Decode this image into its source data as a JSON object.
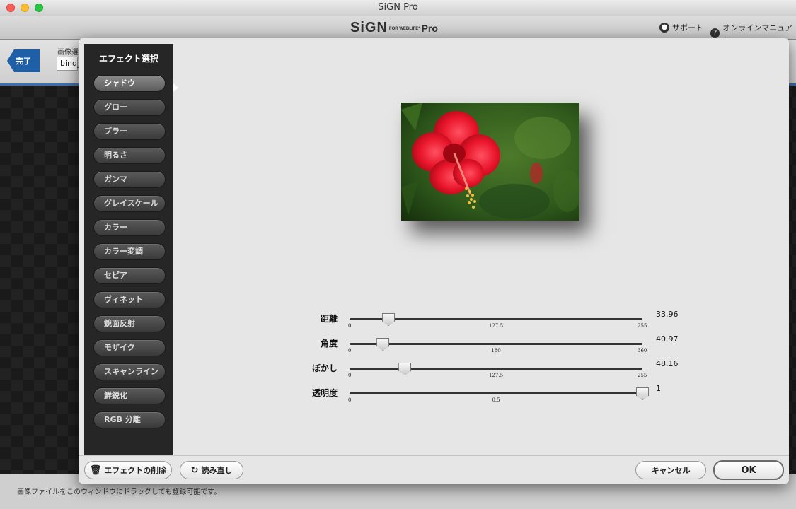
{
  "window": {
    "title": "SiGN Pro"
  },
  "app": {
    "logo_main": "SiGN",
    "logo_sub": "FOR WEBLIFE*",
    "logo_pro": "Pro",
    "support_label": "サポート",
    "manual_label": "オンラインマニュアル"
  },
  "background": {
    "done_label": "完了",
    "field_label": "画像選",
    "field_value": "bind_",
    "status_text": "画像ファイルをこのウィンドウにドラッグしても登録可能です。"
  },
  "dialog": {
    "sidebar_title": "エフェクト選択",
    "effects": [
      "シャドウ",
      "グロー",
      "ブラー",
      "明るさ",
      "ガンマ",
      "グレイスケール",
      "カラー",
      "カラー変調",
      "セピア",
      "ヴィネット",
      "鏡面反射",
      "モザイク",
      "スキャンライン",
      "鮮鋭化",
      "RGB 分離"
    ],
    "active_effect_index": 0,
    "sliders": [
      {
        "label": "距離",
        "min": "0",
        "mid": "127.5",
        "max": "255",
        "value": "33.96",
        "fraction": 0.133
      },
      {
        "label": "角度",
        "min": "0",
        "mid": "180",
        "max": "360",
        "value": "40.97",
        "fraction": 0.114
      },
      {
        "label": "ぼかし",
        "min": "0",
        "mid": "127.5",
        "max": "255",
        "value": "48.16",
        "fraction": 0.189
      },
      {
        "label": "透明度",
        "min": "0",
        "mid": "0.5",
        "max": "",
        "value": "1",
        "fraction": 1.0
      }
    ],
    "buttons": {
      "delete": "エフェクトの削除",
      "reload": "読み直し",
      "cancel": "キャンセル",
      "ok": "OK"
    }
  }
}
